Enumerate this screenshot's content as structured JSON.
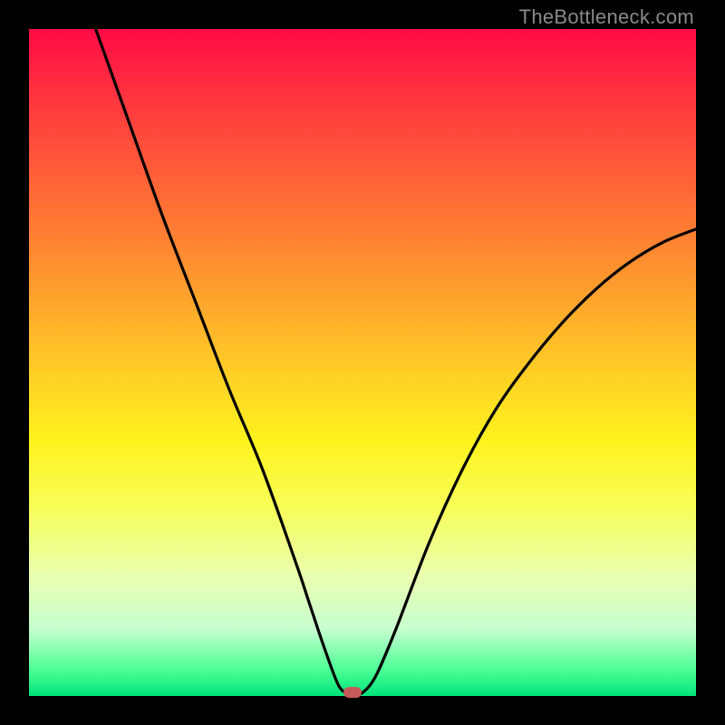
{
  "watermark": "TheBottleneck.com",
  "chart_data": {
    "type": "line",
    "title": "",
    "xlabel": "",
    "ylabel": "",
    "xlim": [
      0,
      100
    ],
    "ylim": [
      0,
      100
    ],
    "grid": false,
    "legend": false,
    "series": [
      {
        "name": "bottleneck-curve",
        "color": "#000000",
        "x": [
          10,
          15,
          20,
          25,
          30,
          35,
          40,
          42,
          44,
          46,
          47,
          48,
          49,
          50,
          52,
          55,
          60,
          65,
          70,
          75,
          80,
          85,
          90,
          95,
          100
        ],
        "y": [
          100,
          86,
          72,
          59,
          46,
          34,
          20,
          14,
          8,
          2.5,
          0.8,
          0.5,
          0.5,
          0.5,
          3,
          10,
          23,
          34,
          43,
          50,
          56,
          61,
          65,
          68,
          70
        ]
      }
    ],
    "marker": {
      "x": 48.5,
      "y": 0.6,
      "color": "#c65a5a"
    },
    "background_gradient": {
      "direction": "vertical",
      "stops": [
        {
          "pos": 0,
          "color": "#ff0b46"
        },
        {
          "pos": 50,
          "color": "#ffc927"
        },
        {
          "pos": 72,
          "color": "#f7ff5a"
        },
        {
          "pos": 100,
          "color": "#00e47a"
        }
      ]
    }
  }
}
